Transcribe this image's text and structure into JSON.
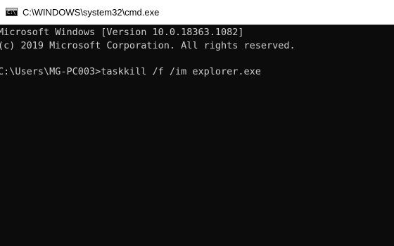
{
  "window": {
    "title": "C:\\WINDOWS\\system32\\cmd.exe",
    "icon": "cmd-icon",
    "icon_text": "C:\\"
  },
  "console": {
    "lines": [
      "Microsoft Windows [Version 10.0.18363.1082]",
      "(c) 2019 Microsoft Corporation. All rights reserved.",
      "C:\\Users\\MG-PC003>taskkill /f /im explorer.exe"
    ],
    "background": "#0c0c0c",
    "foreground": "#cccccc"
  }
}
